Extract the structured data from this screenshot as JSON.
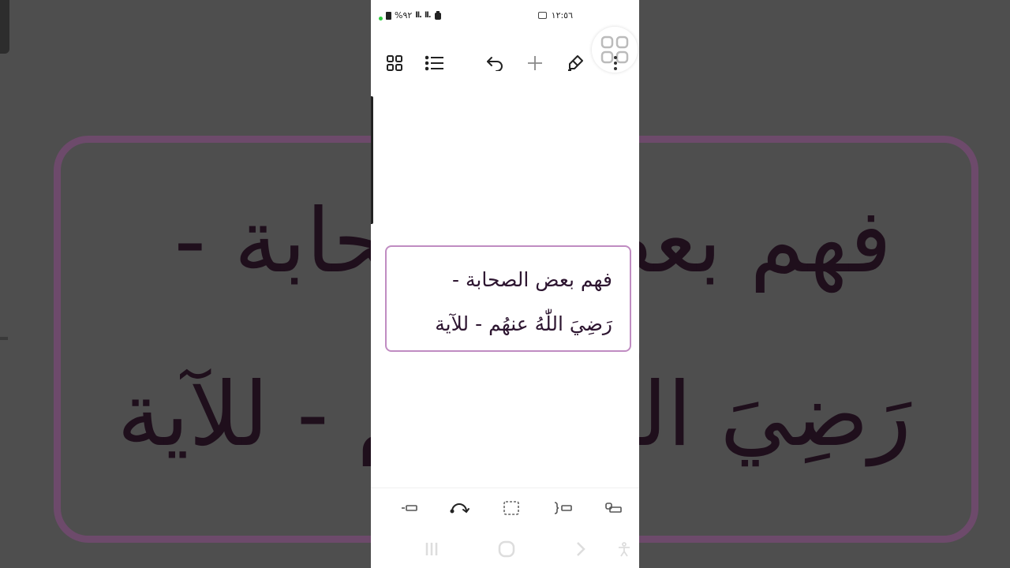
{
  "status_bar": {
    "battery_text": "%٩٢",
    "signal_1": "ll.",
    "signal_2": "ll.",
    "time": "١٢:٥٦"
  },
  "toolbar": {
    "icons": [
      "grid-icon",
      "list-icon",
      "undo-icon",
      "add-icon",
      "pen-icon",
      "more-icon"
    ]
  },
  "note": {
    "line1": "فهم بعض الصحابة -",
    "line2": "رَضِيَ اللّٰهُ عنهُم - للآية"
  },
  "bottom_tools": {
    "icons": [
      "text-box-icon",
      "redo-curve-icon",
      "selection-icon",
      "bracket-icon",
      "shape-icon"
    ]
  },
  "nav": {
    "icons": [
      "recents-icon",
      "home-icon",
      "back-icon",
      "accessibility-icon"
    ]
  },
  "colors": {
    "card_border": "#c08cc2",
    "ink": "#2d1530",
    "background": "#4e4e4e"
  }
}
